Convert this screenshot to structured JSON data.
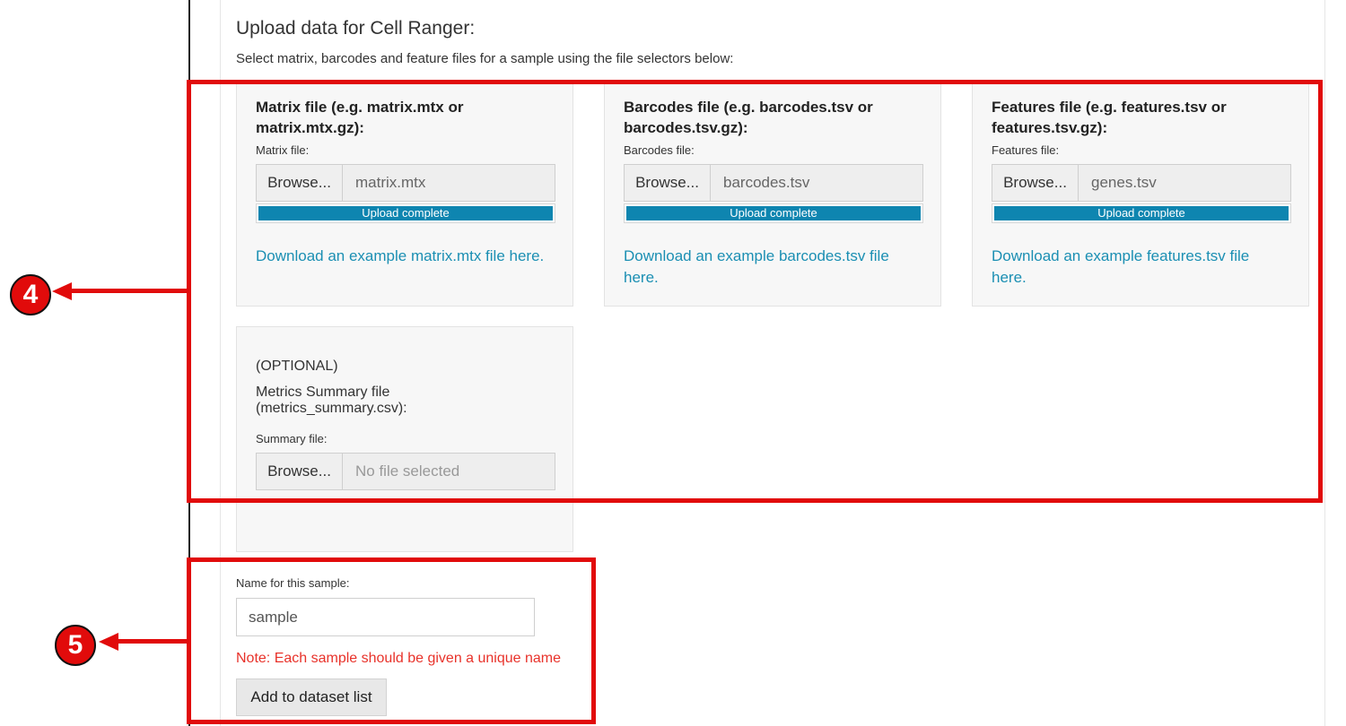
{
  "page": {
    "heading": "Upload data for Cell Ranger:",
    "subheading": "Select matrix, barcodes and feature files for a sample using the file selectors below:"
  },
  "matrix": {
    "title": "Matrix file (e.g. matrix.mtx or matrix.mtx.gz):",
    "label": "Matrix file:",
    "browse": "Browse...",
    "filename": "matrix.mtx",
    "progress_text": "Upload complete",
    "progress": 1.0,
    "link": "Download an example matrix.mtx file here."
  },
  "barcodes": {
    "title": "Barcodes file (e.g. barcodes.tsv or barcodes.tsv.gz):",
    "label": "Barcodes file:",
    "browse": "Browse...",
    "filename": "barcodes.tsv",
    "progress_text": "Upload complete",
    "progress": 1.0,
    "link": "Download an example barcodes.tsv file here."
  },
  "features": {
    "title": "Features file (e.g. features.tsv or features.tsv.gz):",
    "label": "Features file:",
    "browse": "Browse...",
    "filename": "genes.tsv",
    "progress_text": "Upload complete",
    "progress": 1.0,
    "link": "Download an example features.tsv file here."
  },
  "summary": {
    "optional": "(OPTIONAL)",
    "title_line1": "Metrics Summary file",
    "title_line2": "(metrics_summary.csv):",
    "label": "Summary file:",
    "browse": "Browse...",
    "placeholder": "No file selected"
  },
  "sample": {
    "label": "Name for this sample:",
    "value": "sample",
    "note": "Note: Each sample should be given a unique name",
    "add_button": "Add to dataset list"
  },
  "annotations": {
    "callout_4": "4",
    "callout_5": "5",
    "color": "#e10b0b"
  }
}
